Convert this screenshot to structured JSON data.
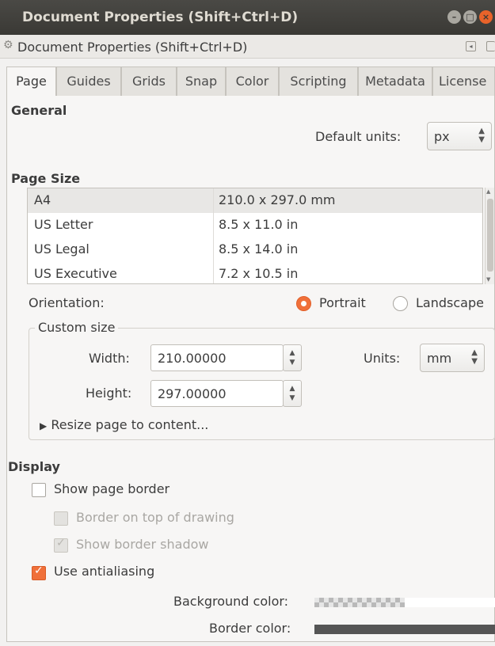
{
  "window": {
    "title": "Document Properties (Shift+Ctrl+D)",
    "buttons": {
      "minimize_icon": "–",
      "maximize_icon": "□",
      "close_icon": "×"
    }
  },
  "dock": {
    "title": "Document Properties (Shift+Ctrl+D)"
  },
  "tabs": [
    {
      "label": "Page",
      "active": true
    },
    {
      "label": "Guides"
    },
    {
      "label": "Grids"
    },
    {
      "label": "Snap"
    },
    {
      "label": "Color"
    },
    {
      "label": "Scripting"
    },
    {
      "label": "Metadata"
    },
    {
      "label": "License"
    }
  ],
  "general": {
    "heading": "General",
    "default_units_label": "Default units:",
    "default_units_value": "px"
  },
  "page_size": {
    "heading": "Page Size",
    "rows": [
      {
        "name": "A4",
        "size": "210.0 x 297.0 mm",
        "selected": true
      },
      {
        "name": "US Letter",
        "size": "8.5 x 11.0 in"
      },
      {
        "name": "US Legal",
        "size": "8.5 x 14.0 in"
      },
      {
        "name": "US Executive",
        "size": "7.2 x 10.5 in"
      }
    ],
    "orientation_label": "Orientation:",
    "portrait_label": "Portrait",
    "landscape_label": "Landscape",
    "orientation_selected": "Portrait"
  },
  "custom_size": {
    "legend": "Custom size",
    "width_label": "Width:",
    "width_value": "210.00000",
    "height_label": "Height:",
    "height_value": "297.00000",
    "units_label": "Units:",
    "units_value": "mm",
    "resize_label": "Resize page to content..."
  },
  "display": {
    "heading": "Display",
    "show_page_border": "Show page border",
    "border_on_top": "Border on top of drawing",
    "show_border_shadow": "Show border shadow",
    "use_antialiasing": "Use antialiasing",
    "background_color_label": "Background color:",
    "border_color_label": "Border color:",
    "border_color": "#555555",
    "accent_color": "#f0703a"
  }
}
